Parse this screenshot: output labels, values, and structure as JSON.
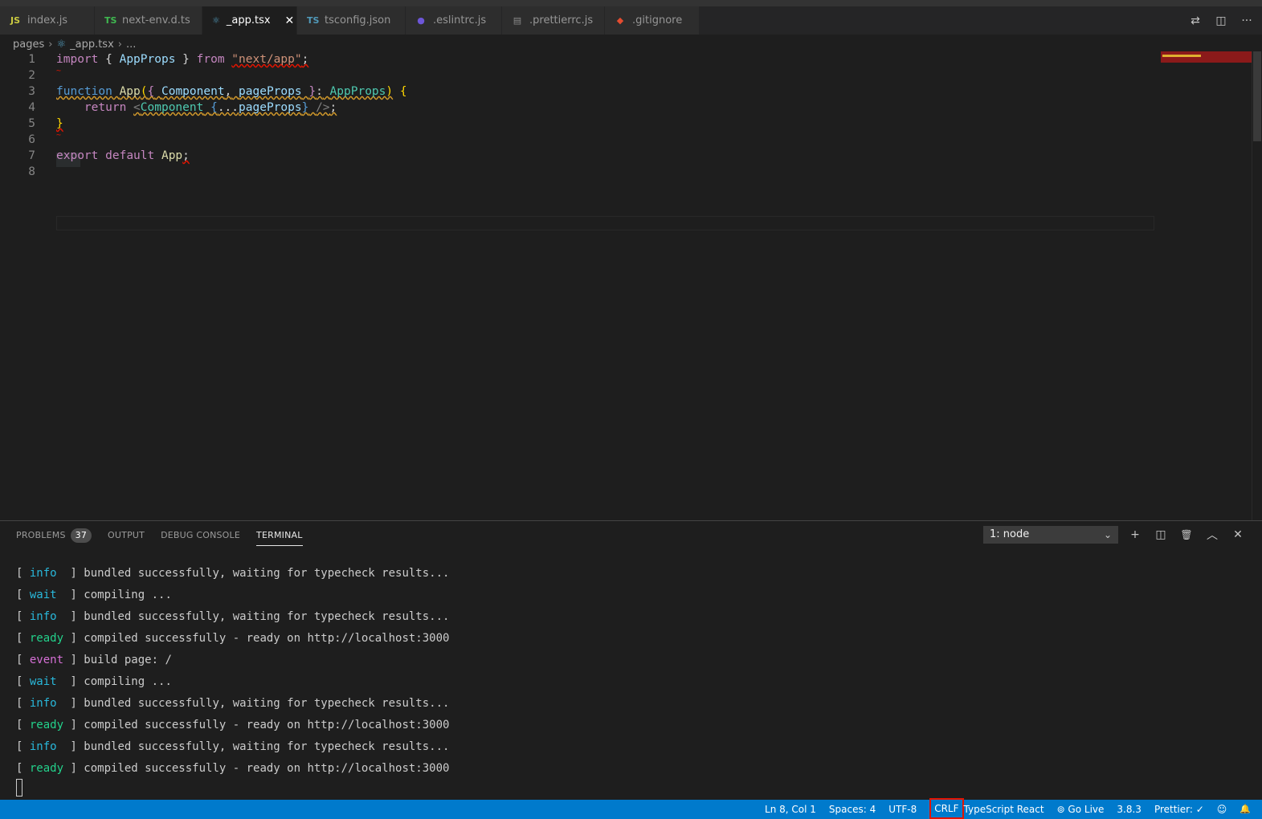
{
  "tabs": [
    {
      "icon": "JS",
      "icon_color": "#cbcb41",
      "label": "index.js"
    },
    {
      "icon": "TS",
      "icon_color": "#3fb950",
      "label": "next-env.d.ts"
    },
    {
      "icon": "⚛",
      "icon_color": "#519aba",
      "label": "_app.tsx",
      "active": true
    },
    {
      "icon": "TS",
      "icon_color": "#519aba",
      "label": "tsconfig.json"
    },
    {
      "icon": "●",
      "icon_color": "#6d56d8",
      "label": ".eslintrc.js"
    },
    {
      "icon": "▤",
      "icon_color": "#8a8a8a",
      "label": ".prettierrc.js"
    },
    {
      "icon": "◆",
      "icon_color": "#e44c30",
      "label": ".gitignore"
    }
  ],
  "tab_close": "✕",
  "tab_actions": {
    "compare": "⇄",
    "split": "◫",
    "more": "···"
  },
  "breadcrumb": {
    "folder": "pages",
    "file_icon": "⚛",
    "file": "_app.tsx",
    "ellipsis": "..."
  },
  "editor": {
    "line_numbers": [
      "1",
      "2",
      "3",
      "4",
      "5",
      "6",
      "7",
      "8"
    ],
    "line1": {
      "import": "import",
      "open": "{",
      "name": "AppProps",
      "close": "}",
      "from": "from",
      "path": "\"next/app\"",
      "semi": ";"
    },
    "line2": {
      "tilde": "~"
    },
    "line3": {
      "function": "function",
      "name": "App",
      "paren": "(",
      "open": "{",
      "p1": "Component",
      "comma": ",",
      "p2": "pageProps",
      "close": "}",
      "colon": ":",
      "type": "AppProps",
      "rparen": ")",
      "brace": "{"
    },
    "line4": {
      "return": "return",
      "lt": "<",
      "comp": "Component",
      "open": "{",
      "spread": "...",
      "props": "pageProps",
      "close": "}",
      "end": "/>",
      "semi": ";"
    },
    "line5": {
      "brace": "}"
    },
    "line6": {
      "tilde": "~"
    },
    "line7": {
      "export": "export",
      "default": "default",
      "name": "App",
      "semi": ";"
    }
  },
  "panel": {
    "tabs": [
      {
        "label": "PROBLEMS",
        "badge": "37"
      },
      {
        "label": "OUTPUT"
      },
      {
        "label": "DEBUG CONSOLE"
      },
      {
        "label": "TERMINAL",
        "active": true
      }
    ],
    "terminal_select": "1: node",
    "select_chevron": "⌄",
    "actions": {
      "add": "+",
      "split": "◫",
      "trash": "🗑",
      "maximize": "︿",
      "close": "✕"
    }
  },
  "terminal_lines": [
    {
      "level": "info",
      "pad": " ",
      "text": " bundled successfully, waiting for typecheck results..."
    },
    {
      "level": "wait",
      "pad": " ",
      "text": " compiling ..."
    },
    {
      "level": "info",
      "pad": " ",
      "text": " bundled successfully, waiting for typecheck results..."
    },
    {
      "level": "ready",
      "pad": "",
      "text": " compiled successfully - ready on http://localhost:3000"
    },
    {
      "level": "event",
      "pad": "",
      "text": " build page: /"
    },
    {
      "level": "wait",
      "pad": " ",
      "text": " compiling ..."
    },
    {
      "level": "info",
      "pad": " ",
      "text": " bundled successfully, waiting for typecheck results..."
    },
    {
      "level": "ready",
      "pad": "",
      "text": " compiled successfully - ready on http://localhost:3000"
    },
    {
      "level": "info",
      "pad": " ",
      "text": " bundled successfully, waiting for typecheck results..."
    },
    {
      "level": "ready",
      "pad": "",
      "text": " compiled successfully - ready on http://localhost:3000"
    }
  ],
  "statusbar": {
    "position": "Ln 8, Col 1",
    "spaces": "Spaces: 4",
    "encoding": "UTF-8",
    "eol": "CRLF",
    "language": "TypeScript React",
    "golive": "⊚ Go Live",
    "version": "3.8.3",
    "prettier": "Prettier: ✓",
    "feedback": "☺",
    "bell": "🔔"
  },
  "colors": {
    "statusbar": "#007acc",
    "highlight_box": "#e51400",
    "editor_bg": "#1e1e1e"
  }
}
